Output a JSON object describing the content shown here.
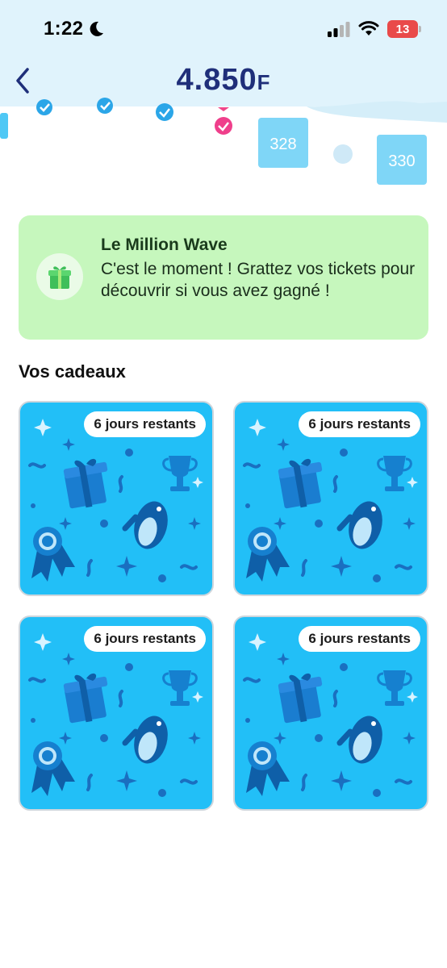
{
  "status_bar": {
    "time": "1:22",
    "battery": "13"
  },
  "header": {
    "balance": "4.850",
    "currency": "F"
  },
  "board": {
    "tickets": [
      "328",
      "330"
    ]
  },
  "banner": {
    "title": "Le Million Wave",
    "text": "C'est le moment ! Grattez vos tickets pour découvrir si vous avez gagné !"
  },
  "gifts": {
    "title": "Vos cadeaux",
    "cards": [
      {
        "badge": "6 jours restants"
      },
      {
        "badge": "6 jours restants"
      },
      {
        "badge": "6 jours restants"
      },
      {
        "badge": "6 jours restants"
      }
    ]
  },
  "colors": {
    "header_bg": "#e0f3fc",
    "banner_bg": "#c6f7bd",
    "card_bg": "#22bff7",
    "balance": "#1f2f7a"
  },
  "icons": [
    "moon-icon",
    "signal-icon",
    "wifi-icon",
    "battery-icon",
    "back-chevron-icon",
    "gift-icon",
    "check-icon",
    "penguin-icon",
    "trophy-icon",
    "ribbon-icon",
    "gift-box-icon"
  ]
}
